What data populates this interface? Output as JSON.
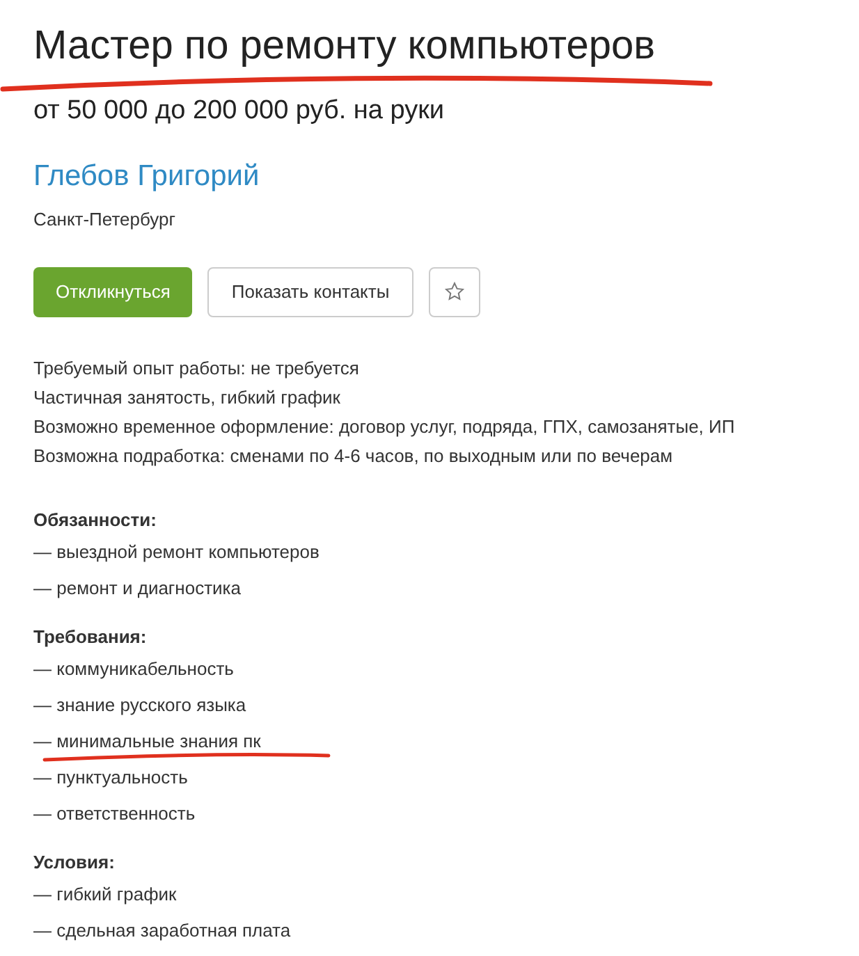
{
  "vacancy": {
    "title": "Мастер по ремонту компьютеров",
    "title_underlined": true,
    "salary": "от 50 000 до 200 000 руб. на руки"
  },
  "employer": {
    "name": "Глебов Григорий",
    "city": "Санкт-Петербург"
  },
  "buttons": [
    {
      "kind": "primary",
      "label": "Откликнуться"
    },
    {
      "kind": "secondary",
      "label": "Показать контакты"
    },
    {
      "kind": "favorite"
    }
  ],
  "conditions": [
    "Требуемый опыт работы: не требуется",
    "Частичная занятость, гибкий график",
    "Возможно временное оформление: договор услуг, подряда, ГПХ, самозанятые, ИП",
    "Возможна подработка: сменами по 4-6 часов, по выходным или по вечерам"
  ],
  "sections": [
    {
      "heading": "Обязанности:",
      "items": [
        {
          "text": "— выездной ремонт компьютеров",
          "underlined": false
        },
        {
          "text": "— ремонт и диагностика",
          "underlined": false
        }
      ]
    },
    {
      "heading": "Требования:",
      "items": [
        {
          "text": "— коммуникабельность",
          "underlined": false
        },
        {
          "text": "— знание русского языка",
          "underlined": false
        },
        {
          "text": "— минимальные знания пк",
          "underlined": true
        },
        {
          "text": "— пунктуальность",
          "underlined": false
        },
        {
          "text": "— ответственность",
          "underlined": false
        }
      ]
    },
    {
      "heading": "Условия:",
      "items": [
        {
          "text": "— гибкий график",
          "underlined": false
        },
        {
          "text": "— сдельная заработная плата",
          "underlined": false
        }
      ]
    }
  ]
}
